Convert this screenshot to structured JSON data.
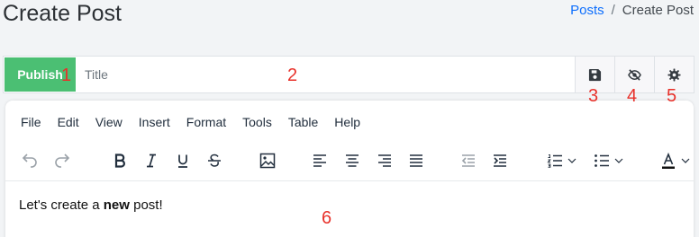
{
  "header": {
    "title": "Create Post",
    "breadcrumb": {
      "link": "Posts",
      "separator": "/",
      "current": "Create Post"
    }
  },
  "editor_bar": {
    "publish_label": "Publish",
    "title_placeholder": "Title",
    "buttons": [
      {
        "name": "save",
        "icon": "floppy-disk-icon"
      },
      {
        "name": "preview",
        "icon": "eye-slash-icon"
      },
      {
        "name": "settings",
        "icon": "gear-icon"
      }
    ]
  },
  "menubar": [
    "File",
    "Edit",
    "View",
    "Insert",
    "Format",
    "Tools",
    "Table",
    "Help"
  ],
  "toolbar_icons": [
    "undo-icon",
    "redo-icon",
    "bold-icon",
    "italic-icon",
    "underline-icon",
    "strikethrough-icon",
    "image-icon",
    "align-left-icon",
    "align-center-icon",
    "align-right-icon",
    "justify-icon",
    "outdent-icon",
    "indent-icon",
    "numbered-list-icon",
    "bullet-list-icon",
    "text-color-icon"
  ],
  "content": {
    "before": "Let's create a ",
    "bold": "new",
    "after": " post!"
  },
  "markers": [
    "1",
    "2",
    "3",
    "4",
    "5",
    "6"
  ],
  "colors": {
    "publish": "#4bbf73",
    "link": "#0d6efd",
    "marker": "#e8312a",
    "background": "#f2f4f6"
  }
}
